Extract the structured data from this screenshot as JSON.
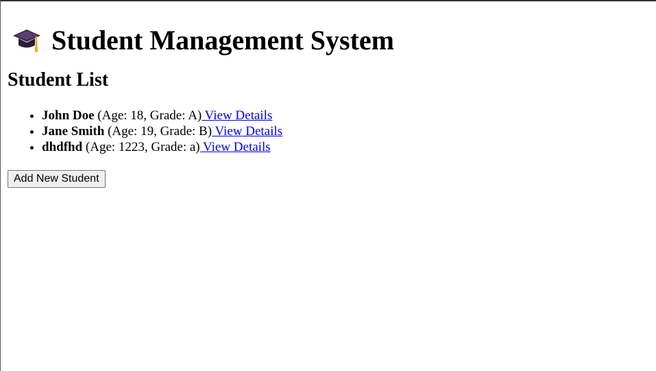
{
  "header": {
    "title": "Student Management System",
    "icon": "graduation-cap-icon"
  },
  "student_list": {
    "heading": "Student List",
    "students": [
      {
        "name": "John Doe",
        "info": "(Age: 18, Grade: A)",
        "link_label": " View Details"
      },
      {
        "name": "Jane Smith",
        "info": "(Age: 19, Grade: B)",
        "link_label": " View Details"
      },
      {
        "name": "dhdfhd",
        "info": "(Age: 1223, Grade: a)",
        "link_label": " View Details"
      }
    ]
  },
  "actions": {
    "add_label": "Add New Student"
  },
  "colors": {
    "link": "#0000ee",
    "cap_primary": "#3b2a4a",
    "cap_tassel": "#f5a623"
  }
}
